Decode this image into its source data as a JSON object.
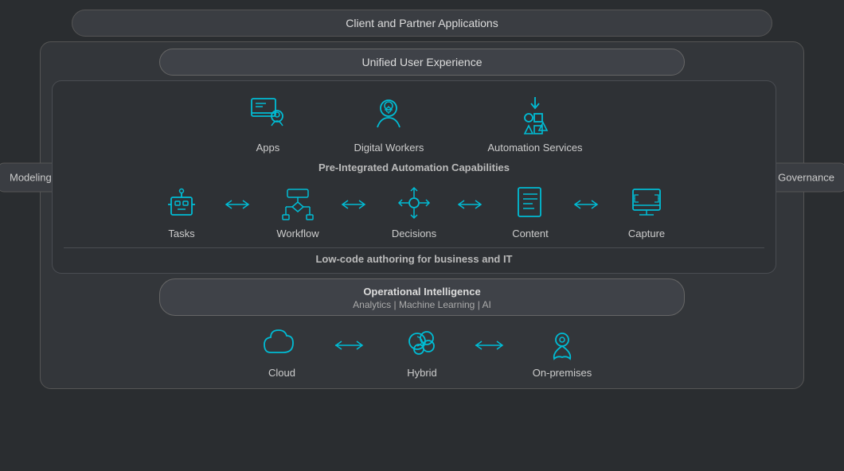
{
  "header": {
    "client_apps": "Client and Partner Applications",
    "unified_ux": "Unified User Experience"
  },
  "side_labels": {
    "modeling": "Modeling",
    "governance": "Governance"
  },
  "top_icons": [
    {
      "label": "Apps",
      "id": "apps"
    },
    {
      "label": "Digital Workers",
      "id": "digital-workers"
    },
    {
      "label": "Automation Services",
      "id": "automation-services"
    }
  ],
  "preintegrated_label": "Pre-Integrated Automation Capabilities",
  "automation_items": [
    {
      "label": "Tasks",
      "id": "tasks"
    },
    {
      "label": "Workflow",
      "id": "workflow"
    },
    {
      "label": "Decisions",
      "id": "decisions"
    },
    {
      "label": "Content",
      "id": "content"
    },
    {
      "label": "Capture",
      "id": "capture"
    }
  ],
  "lowcode_label": "Low-code authoring for business and IT",
  "ops_intel": {
    "title": "Operational Intelligence",
    "subtitle": "Analytics  |  Machine Learning  |  AI"
  },
  "deployment_items": [
    {
      "label": "Cloud",
      "id": "cloud"
    },
    {
      "label": "Hybrid",
      "id": "hybrid"
    },
    {
      "label": "On-premises",
      "id": "on-premises"
    }
  ]
}
